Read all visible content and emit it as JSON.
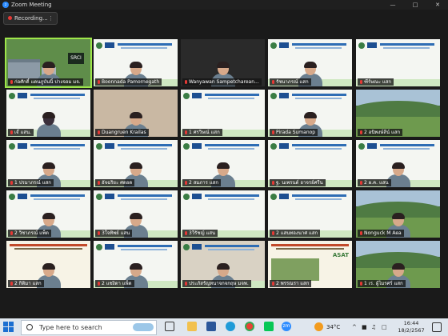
{
  "window": {
    "title": "Zoom Meeting",
    "app_icon": "zoom-icon",
    "controls": [
      "minimize-icon",
      "maximize-icon",
      "close-icon"
    ]
  },
  "recording": {
    "label": "Recording...",
    "status_color": "#e53935",
    "more_icon": "ellipsis-icon"
  },
  "participants": [
    {
      "name": "ก่อศักดิ์ แดนภูบันนิ์ ปางจอม มจ.",
      "type": "building-banner",
      "active": true,
      "banner": "SRCI"
    },
    {
      "name": "Boonnada Pamornegath",
      "type": "banner-person"
    },
    {
      "name": "Wanyawan Sampetcharean...",
      "type": "dark-person"
    },
    {
      "name": "รัชนาภรณ์ แสก",
      "type": "banner-person"
    },
    {
      "name": "ฑีร์ษณะ แสก",
      "type": "banner"
    },
    {
      "name": "เจ๊ แสน.",
      "type": "banner-mask"
    },
    {
      "name": "Duangruen Krailas",
      "type": "person"
    },
    {
      "name": "1 ศรวิษณ์ แสก",
      "type": "banner"
    },
    {
      "name": "Pirada Sumanop",
      "type": "banner-person"
    },
    {
      "name": "2 อนิพงษ์ลีน์ แสก",
      "type": "photo"
    },
    {
      "name": "1 ปรมาภรณ์ แสก",
      "type": "banner-person"
    },
    {
      "name": "อัจฉริยะ ศดอด",
      "type": "banner-person"
    },
    {
      "name": "2 สมภาร แสก",
      "type": "banner-person"
    },
    {
      "name": "ฐ. นเพรนต์ อาจรย์ศรีน",
      "type": "banner"
    },
    {
      "name": "2 ผ.ค. แสน",
      "type": "banner-person"
    },
    {
      "name": "2 วิชาภรณ์ แพ็ต",
      "type": "banner-person"
    },
    {
      "name": "3ใจทิพย์ แสน",
      "type": "banner-person"
    },
    {
      "name": "3วีรัชญ์ แสน",
      "type": "banner"
    },
    {
      "name": "2 แสนทองนาศ แสก",
      "type": "banner"
    },
    {
      "name": "Nonguck M Aea",
      "type": "photo-person"
    },
    {
      "name": "2 กิติมา แสก",
      "type": "poster-person"
    },
    {
      "name": "2 แชงิดา แพ็ด",
      "type": "banner-person"
    },
    {
      "name": "ประภัสรัญทนาจกจกฤษ มจพ.",
      "type": "speaker"
    },
    {
      "name": "2 พรรณรา แสก",
      "type": "poster"
    },
    {
      "name": "1 เร. ผู้ไมรศร์ แสก",
      "type": "photo-person"
    }
  ],
  "taskbar": {
    "search_placeholder": "Type here to search",
    "pinned_icons": [
      "task-view-icon",
      "file-explorer-icon",
      "word-icon",
      "edge-icon",
      "teams-icon",
      "chrome-icon",
      "line-icon",
      "zoom-icon"
    ],
    "weather_temp": "34°C",
    "time": "16:44",
    "date": "18/2/2567"
  },
  "colors": {
    "active_speaker": "#9ee64a",
    "zoom_blue": "#2d8cff",
    "taskbar_bg": "#dfe6ee"
  }
}
